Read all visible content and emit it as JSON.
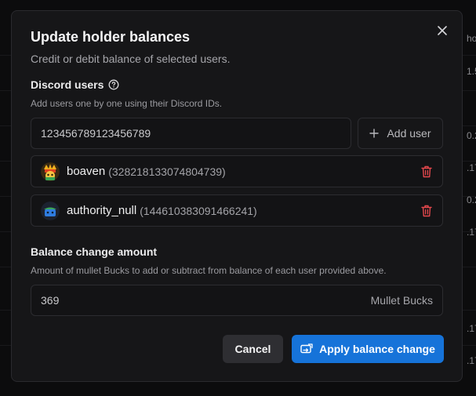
{
  "background": {
    "fragments": [
      "ho",
      "1.5",
      "0.2",
      ".17",
      "0.2",
      ".17",
      ".17",
      ".17"
    ]
  },
  "dialog": {
    "title": "Update holder balances",
    "subtitle": "Credit or debit balance of selected users.",
    "discord_section": {
      "label": "Discord users",
      "description": "Add users one by one using their Discord IDs.",
      "input_value": "123456789123456789",
      "add_button_label": "Add user"
    },
    "users": [
      {
        "name": "boaven",
        "id": "(328218133074804739)"
      },
      {
        "name": "authority_null",
        "id": "(144610383091466241)"
      }
    ],
    "balance_section": {
      "label": "Balance change amount",
      "description": "Amount of mullet Bucks to add or subtract from balance of each user provided above.",
      "amount_value": "369",
      "unit": "Mullet Bucks"
    },
    "cancel_label": "Cancel",
    "apply_label": "Apply balance change"
  },
  "colors": {
    "accent": "#1673d9",
    "danger": "#e5484d",
    "modal_bg": "#161618"
  }
}
